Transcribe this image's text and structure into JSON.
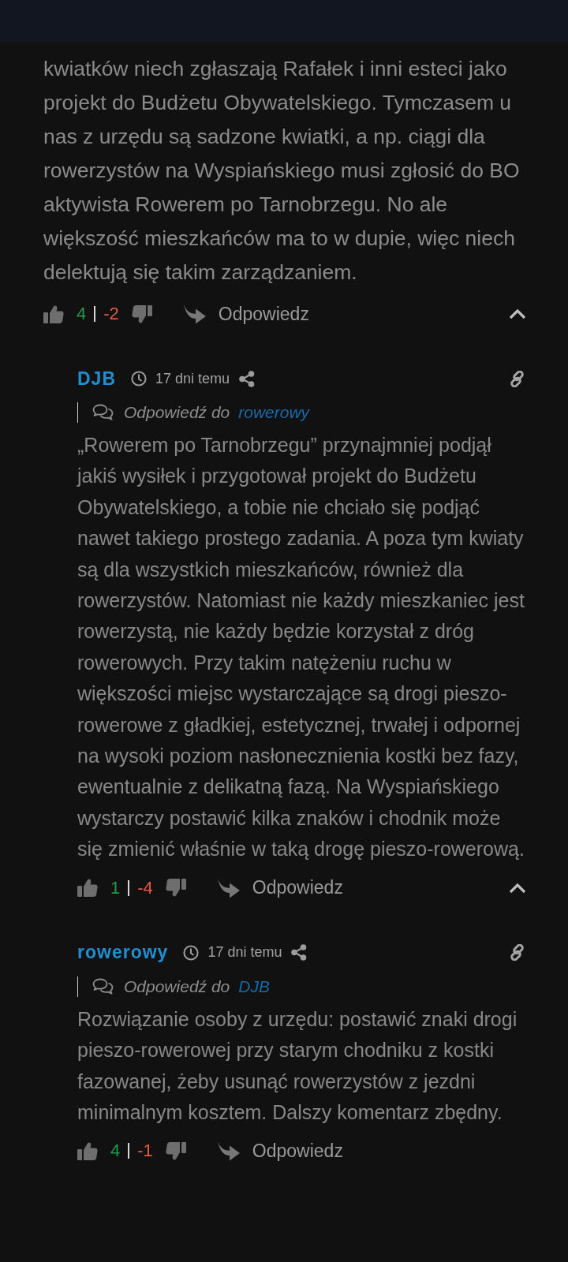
{
  "comment": {
    "text": "kwiatków niech zgłaszają Rafałek i inni esteci jako projekt do Budżetu Obywatelskiego. Tymczasem u nas z urzędu są sadzone kwiatki, a np. ciągi dla rowerzystów na Wyspiańskiego musi zgłosić do BO aktywista Rowerem po Tarnobrzegu. No ale większość mieszkańców ma to w dupie, więc niech delektują się takim zarządzaniem.",
    "likes": "4",
    "dislikes": "-2",
    "reply_label": "Odpowiedz",
    "collapsible": true,
    "replies": [
      {
        "author": "DJB",
        "time": "17 dni temu",
        "reply_to_label": "Odpowiedź do",
        "reply_to": "rowerowy",
        "text": "„Rowerem po Tarnobrzegu” przynajmniej podjął jakiś wysiłek i przygotował projekt do Budżetu Obywatelskiego, a tobie nie chciało się podjąć nawet takiego prostego zadania. A poza tym kwiaty są dla wszystkich mieszkańców, również dla rowerzystów. Natomiast nie każdy mieszkaniec jest rowerzystą, nie każdy będzie korzystał z dróg rowerowych. Przy takim natężeniu ruchu w większości miejsc wystarczające są drogi pieszo-rowerowe z gładkiej, estetycznej, trwałej i odpornej na wysoki poziom nasłonecznienia kostki bez fazy, ewentualnie z delikatną fazą. Na Wyspiańskiego wystarczy postawić kilka znaków i chodnik może się zmienić właśnie w taką drogę pieszo-rowerową.",
        "likes": "1",
        "dislikes": "-4",
        "reply_label": "Odpowiedz",
        "collapsible": true
      },
      {
        "author": "rowerowy",
        "time": "17 dni temu",
        "reply_to_label": "Odpowiedź do",
        "reply_to": "DJB",
        "text": "Rozwiązanie osoby z urzędu: postawić znaki drogi pieszo-rowerowej przy starym chodniku z kostki fazowanej, żeby usunąć rowerzystów z jezdni minimalnym kosztem. Dalszy komentarz zbędny.",
        "likes": "4",
        "dislikes": "-1",
        "reply_label": "Odpowiedz",
        "collapsible": false
      }
    ]
  }
}
